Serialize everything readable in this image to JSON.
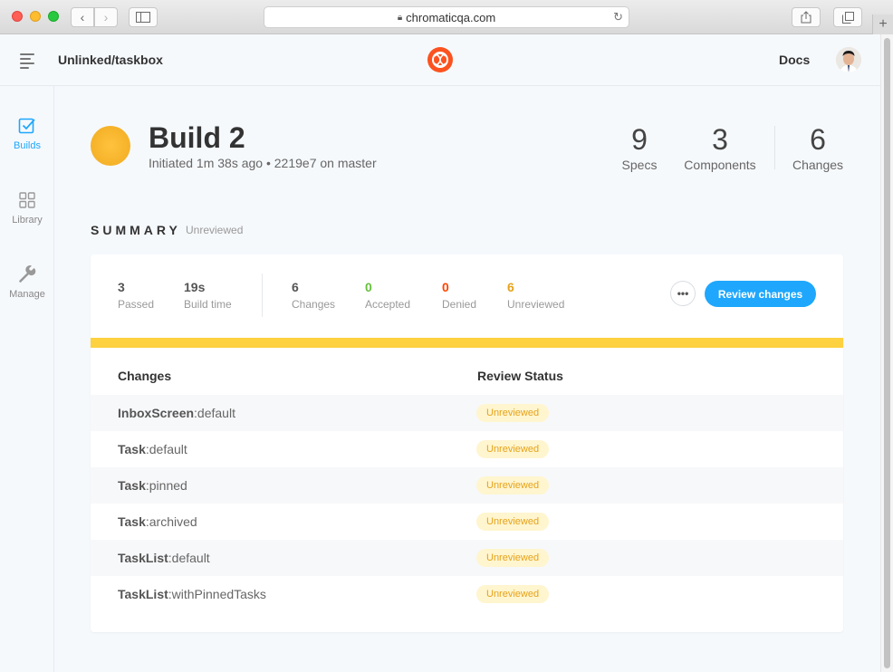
{
  "browser": {
    "url": "chromaticqa.com"
  },
  "header": {
    "project": "Unlinked/taskbox",
    "docs": "Docs"
  },
  "sidebar": {
    "items": [
      {
        "label": "Builds",
        "icon": "checkbox-icon"
      },
      {
        "label": "Library",
        "icon": "grid-icon"
      },
      {
        "label": "Manage",
        "icon": "wrench-icon"
      }
    ]
  },
  "build": {
    "title": "Build 2",
    "meta": "Initiated 1m 38s ago • 2219e7 on master",
    "stats": [
      {
        "value": "9",
        "label": "Specs"
      },
      {
        "value": "3",
        "label": "Components"
      },
      {
        "value": "6",
        "label": "Changes"
      }
    ]
  },
  "summary": {
    "title": "SUMMARY",
    "status": "Unreviewed",
    "metrics": [
      {
        "value": "3",
        "label": "Passed"
      },
      {
        "value": "19s",
        "label": "Build time"
      },
      {
        "value": "6",
        "label": "Changes"
      },
      {
        "value": "0",
        "label": "Accepted"
      },
      {
        "value": "0",
        "label": "Denied"
      },
      {
        "value": "6",
        "label": "Unreviewed"
      }
    ],
    "more_label": "•••",
    "review_button": "Review changes"
  },
  "table": {
    "col_changes": "Changes",
    "col_status": "Review Status",
    "rows": [
      {
        "component": "InboxScreen",
        "story": ":default",
        "status": "Unreviewed"
      },
      {
        "component": "Task",
        "story": ":default",
        "status": "Unreviewed"
      },
      {
        "component": "Task",
        "story": ":pinned",
        "status": "Unreviewed"
      },
      {
        "component": "Task",
        "story": ":archived",
        "status": "Unreviewed"
      },
      {
        "component": "TaskList",
        "story": ":default",
        "status": "Unreviewed"
      },
      {
        "component": "TaskList",
        "story": ":withPinnedTasks",
        "status": "Unreviewed"
      }
    ]
  },
  "colors": {
    "accent": "#1ea7fd",
    "accepted": "#66bf3c",
    "denied": "#ff4400",
    "unreviewed": "#e5a31b",
    "progress": "#fdd13f"
  }
}
